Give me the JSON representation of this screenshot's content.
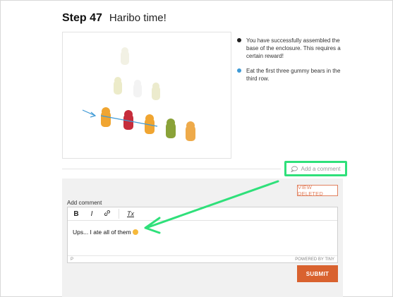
{
  "step": {
    "number": "Step 47",
    "title": "Haribo time!"
  },
  "bullets": [
    {
      "color": "#222222",
      "text": "You have successfully assembled the base of the enclosure. This requires a certain reward!"
    },
    {
      "color": "#3f9ad6",
      "text": "Eat the first three gummy bears in the third row."
    }
  ],
  "add_comment_link": "Add a comment",
  "view_deleted_label": "VIEW DELETED",
  "comment_form": {
    "label": "Add comment",
    "toolbar": {
      "bold": "B",
      "italic": "I",
      "link_icon": "link-icon",
      "clear": "Tx"
    },
    "content": "Ups... I ate all of them",
    "status_path": "P",
    "powered_by": "POWERED BY TINY",
    "submit_label": "SUBMIT"
  },
  "colors": {
    "highlight": "#2fe07a",
    "accent": "#d9622f",
    "annotation_arrow": "#3f9ad6"
  }
}
